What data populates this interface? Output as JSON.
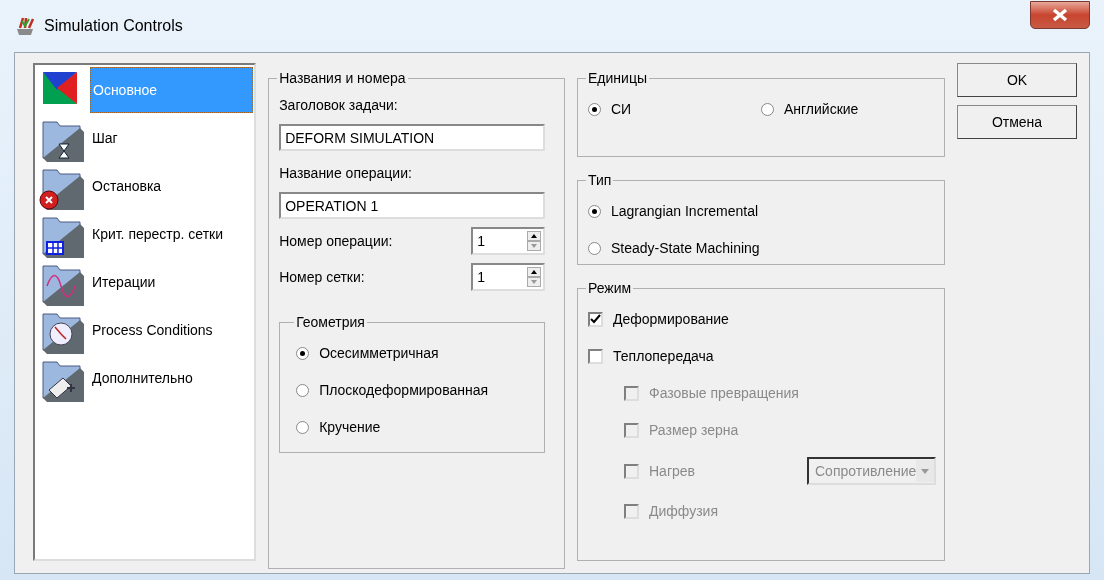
{
  "window": {
    "title": "Simulation Controls"
  },
  "sidebar": {
    "items": [
      {
        "label": "Основное",
        "selected": true
      },
      {
        "label": "Шаг",
        "selected": false
      },
      {
        "label": "Остановка",
        "selected": false
      },
      {
        "label": "Крит. перестр. сетки",
        "selected": false
      },
      {
        "label": "Итерации",
        "selected": false
      },
      {
        "label": "Process Conditions",
        "selected": false
      },
      {
        "label": "Дополнительно",
        "selected": false
      }
    ]
  },
  "names_group": {
    "title": "Названия и номера",
    "fields": [
      {
        "kind": "text",
        "label": "Заголовок задачи:",
        "value": "DEFORM SIMULATION"
      },
      {
        "kind": "text",
        "label": "Название операции:",
        "value": "OPERATION 1"
      },
      {
        "kind": "spin",
        "label": "Номер операции:",
        "value": "1"
      },
      {
        "kind": "spin",
        "label": "Номер сетки:",
        "value": "1"
      }
    ],
    "geometry": {
      "title": "Геометрия",
      "options": [
        {
          "label": "Осесимметричная",
          "selected": true
        },
        {
          "label": "Плоскодеформированная",
          "selected": false
        },
        {
          "label": "Кручение",
          "selected": false
        }
      ]
    }
  },
  "units": {
    "title": "Единицы",
    "options": [
      {
        "label": "СИ",
        "selected": true
      },
      {
        "label": "Английские",
        "selected": false
      }
    ]
  },
  "type": {
    "title": "Тип",
    "options": [
      {
        "label": "Lagrangian Incremental",
        "selected": true
      },
      {
        "label": "Steady-State Machining",
        "selected": false
      }
    ]
  },
  "mode": {
    "title": "Режим",
    "items": [
      {
        "label": "Деформирование",
        "checked": true,
        "disabled": false
      },
      {
        "label": "Теплопередача",
        "checked": false,
        "disabled": false,
        "children": [
          {
            "label": "Фазовые превращения",
            "checked": false,
            "disabled": true
          },
          {
            "label": "Размер зерна",
            "checked": false,
            "disabled": true
          },
          {
            "label": "Нагрев",
            "checked": false,
            "disabled": true,
            "dropdown": {
              "value": "Сопротивление",
              "disabled": true
            }
          },
          {
            "label": "Диффузия",
            "checked": false,
            "disabled": true
          }
        ]
      }
    ]
  },
  "buttons": [
    "OK",
    "Отмена"
  ]
}
